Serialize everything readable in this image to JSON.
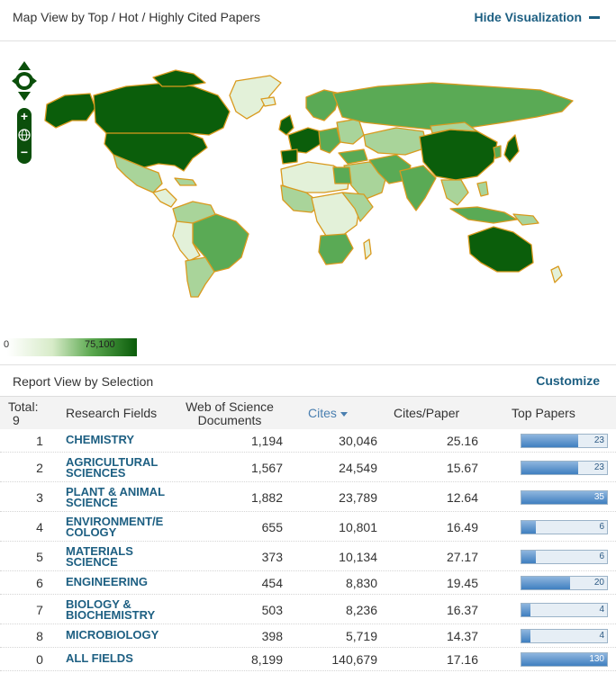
{
  "header": {
    "title": "Map View by Top / Hot / Highly Cited Papers",
    "hide_label": "Hide Visualization"
  },
  "map": {
    "icons": [
      "pan-arrows-icon",
      "zoom-in-icon",
      "globe-icon",
      "zoom-out-icon"
    ],
    "legend": {
      "min": "0",
      "max": "75,100",
      "color_low": "#ffffff",
      "color_high": "#0a5c0a"
    },
    "colors": {
      "darkest": "#0b5e0b",
      "medium": "#5aaa55",
      "light": "#a9d49a",
      "lightest": "#e3f1d9",
      "border": "#d99a1e"
    }
  },
  "report": {
    "title": "Report View by Selection",
    "customize_label": "Customize"
  },
  "table": {
    "headers": {
      "total_label": "Total:",
      "total_value": "9",
      "field": "Research Fields",
      "wos_line1": "Web of Science",
      "wos_line2": "Documents",
      "cites": "Cites",
      "cites_per_paper": "Cites/Paper",
      "top_papers": "Top Papers"
    },
    "rows": [
      {
        "rank": "1",
        "field_l1": "CHEMISTRY",
        "field_l2": "",
        "docs": "1,194",
        "cites": "30,046",
        "cpp": "25.16",
        "top": "23",
        "fill": 0.66
      },
      {
        "rank": "2",
        "field_l1": "AGRICULTURAL",
        "field_l2": "SCIENCES",
        "docs": "1,567",
        "cites": "24,549",
        "cpp": "15.67",
        "top": "23",
        "fill": 0.66
      },
      {
        "rank": "3",
        "field_l1": "PLANT & ANIMAL",
        "field_l2": "SCIENCE",
        "docs": "1,882",
        "cites": "23,789",
        "cpp": "12.64",
        "top": "35",
        "fill": 1.0
      },
      {
        "rank": "4",
        "field_l1": "ENVIRONMENT/E",
        "field_l2": "COLOGY",
        "docs": "655",
        "cites": "10,801",
        "cpp": "16.49",
        "top": "6",
        "fill": 0.17
      },
      {
        "rank": "5",
        "field_l1": "MATERIALS",
        "field_l2": "SCIENCE",
        "docs": "373",
        "cites": "10,134",
        "cpp": "27.17",
        "top": "6",
        "fill": 0.17
      },
      {
        "rank": "6",
        "field_l1": "ENGINEERING",
        "field_l2": "",
        "docs": "454",
        "cites": "8,830",
        "cpp": "19.45",
        "top": "20",
        "fill": 0.57
      },
      {
        "rank": "7",
        "field_l1": "BIOLOGY &",
        "field_l2": "BIOCHEMISTRY",
        "docs": "503",
        "cites": "8,236",
        "cpp": "16.37",
        "top": "4",
        "fill": 0.11
      },
      {
        "rank": "8",
        "field_l1": "MICROBIOLOGY",
        "field_l2": "",
        "docs": "398",
        "cites": "5,719",
        "cpp": "14.37",
        "top": "4",
        "fill": 0.11
      },
      {
        "rank": "0",
        "field_l1": "ALL FIELDS",
        "field_l2": "",
        "docs": "8,199",
        "cites": "140,679",
        "cpp": "17.16",
        "top": "130",
        "fill": 1.0
      }
    ]
  }
}
